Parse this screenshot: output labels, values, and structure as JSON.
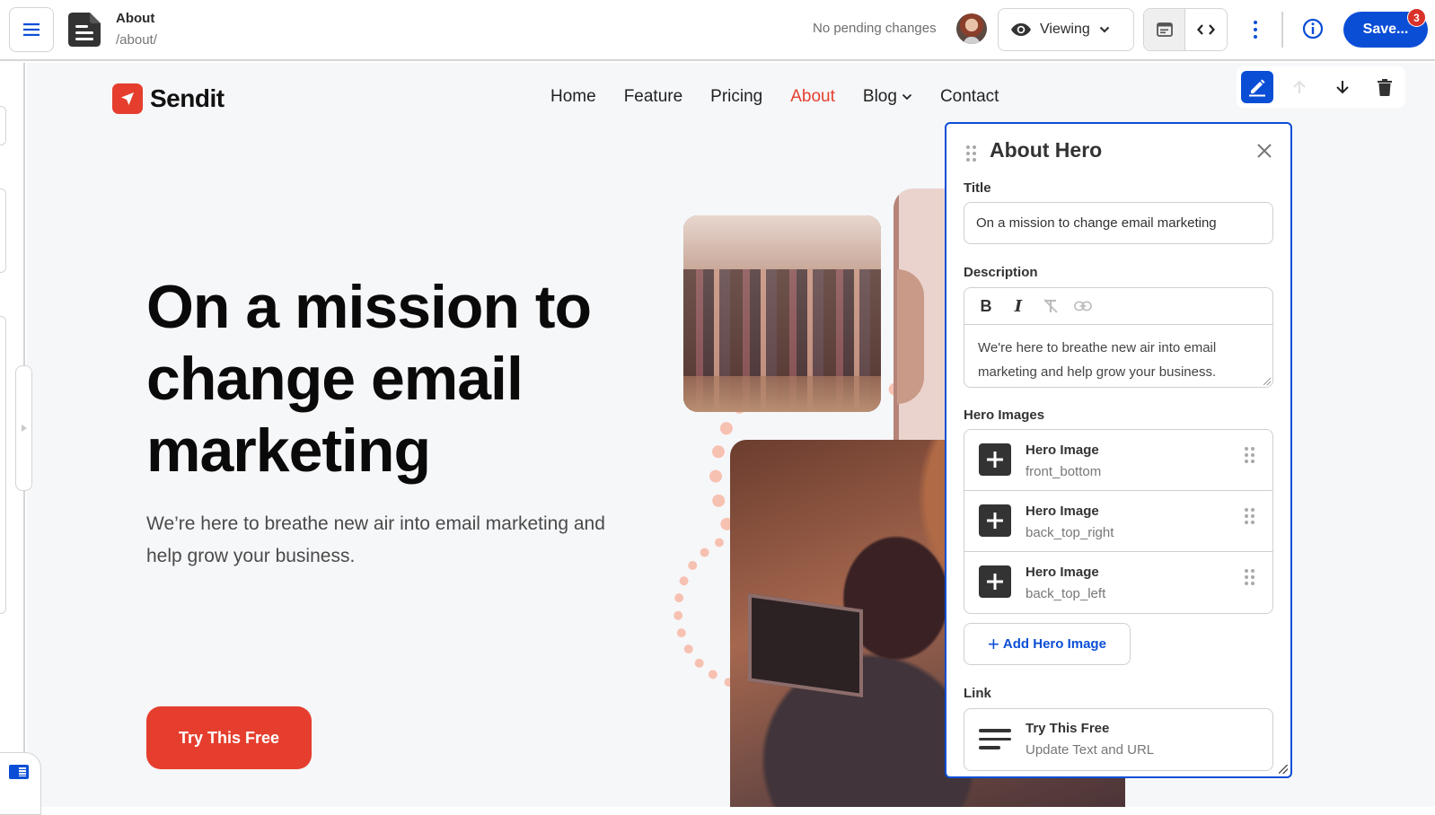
{
  "topbar": {
    "menu_icon": "hamburger-icon",
    "page_icon": "document-icon",
    "page_title": "About",
    "page_path": "/about/",
    "pending_status": "No pending changes",
    "mode_label": "Viewing",
    "mode_icon": "eye-icon",
    "view_toggle": [
      "layout-icon",
      "code-icon"
    ],
    "save_label": "Save...",
    "save_badge_count": "3",
    "accent_color": "#0b4ed6",
    "badge_color": "#d8322a"
  },
  "site": {
    "brand": "Sendit",
    "brand_color": "#e53e2e",
    "nav": [
      {
        "label": "Home",
        "active": false
      },
      {
        "label": "Feature",
        "active": false
      },
      {
        "label": "Pricing",
        "active": false
      },
      {
        "label": "About",
        "active": true
      },
      {
        "label": "Blog",
        "active": false,
        "dropdown": true
      },
      {
        "label": "Contact",
        "active": false
      }
    ],
    "hero_title": "On a mission to change email marketing",
    "hero_description": "We’re here to breathe new air into email marketing and help grow your business.",
    "cta_label": "Try This Free"
  },
  "section_toolbar": {
    "items": [
      "edit-icon",
      "move-up-icon",
      "move-down-icon",
      "delete-icon"
    ]
  },
  "editor_panel": {
    "title": "About Hero",
    "title_field": {
      "label": "Title",
      "value": "On a mission to change email marketing"
    },
    "description_field": {
      "label": "Description",
      "tools": [
        "B",
        "I",
        "clear-format",
        "link"
      ],
      "value": "We're here to breathe new air into email marketing and help grow your business."
    },
    "hero_images": {
      "label": "Hero Images",
      "items": [
        {
          "name": "Hero Image",
          "slot": "front_bottom"
        },
        {
          "name": "Hero Image",
          "slot": "back_top_right"
        },
        {
          "name": "Hero Image",
          "slot": "back_top_left"
        }
      ],
      "add_label": "Add Hero Image"
    },
    "link": {
      "label": "Link",
      "name": "Try This Free",
      "sub": "Update Text and URL"
    }
  }
}
